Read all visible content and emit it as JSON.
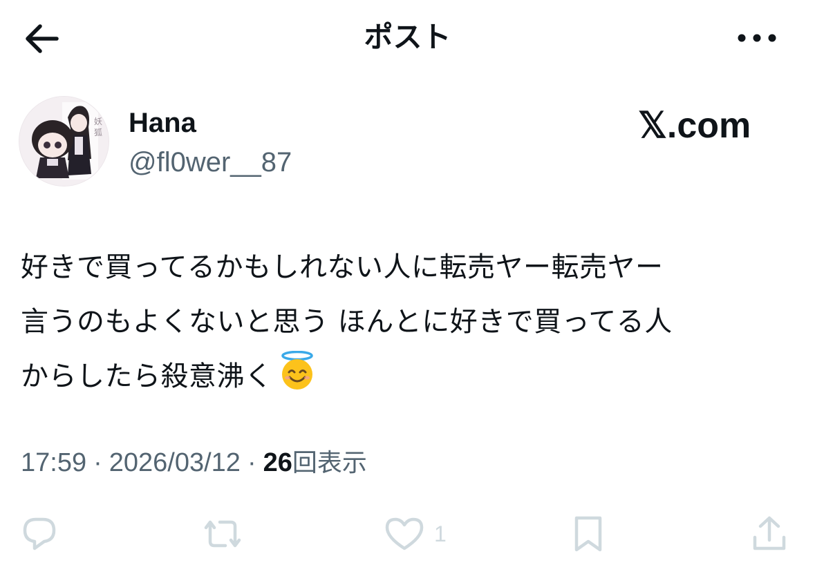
{
  "header": {
    "title": "ポスト",
    "back_icon": "arrow-left-icon",
    "more_icon": "more-horizontal-icon"
  },
  "author": {
    "display_name": "Hana",
    "handle": "@fl0wer__87",
    "avatar_icon": "avatar-image"
  },
  "watermark": {
    "text": "𝕏.com"
  },
  "post": {
    "lines": [
      "好きで買ってるかもしれない人に転売ヤー転売ヤー",
      "言うのもよくないと思う ほんとに好きで買ってる人",
      "からしたら殺意沸く"
    ],
    "emoji": "smiling-face-with-halo"
  },
  "meta": {
    "time": "17:59",
    "date": "2026/03/12",
    "separator": "·",
    "views_count": "26",
    "views_label": "回表示"
  },
  "actions": {
    "reply_icon": "reply-icon",
    "repost_icon": "repost-icon",
    "like_icon": "heart-icon",
    "like_count": "1",
    "bookmark_icon": "bookmark-icon",
    "share_icon": "share-icon"
  },
  "colors": {
    "text_primary": "#0f1419",
    "text_secondary": "#536471",
    "action_icon": "#cfd9de",
    "background": "#ffffff"
  }
}
